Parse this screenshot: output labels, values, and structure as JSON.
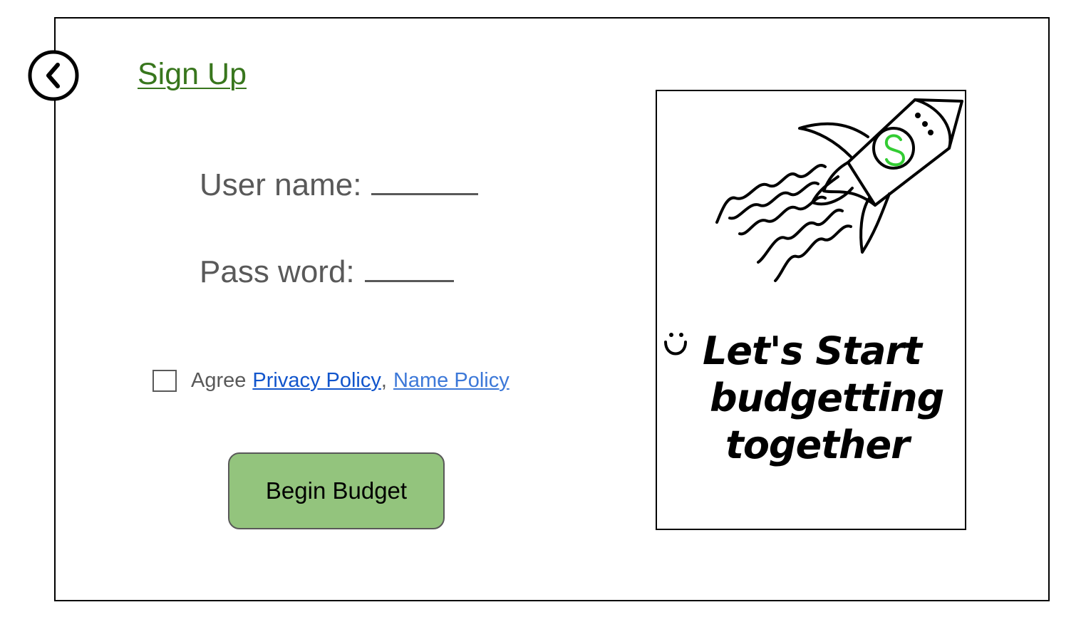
{
  "header": {
    "back_icon": "chevron-left-circle-icon",
    "title": "Sign Up"
  },
  "form": {
    "username_label": "User name:",
    "password_label": "Pass word:",
    "agree_text": "Agree",
    "privacy_link": "Privacy Policy",
    "separator": ",",
    "name_policy_link": "Name Policy",
    "submit_label": "Begin Budget"
  },
  "poster": {
    "icon": "rocket-dollar-icon",
    "line1": "Let's Start",
    "line2": "budgetting",
    "line3": "together",
    "smiley_icon": "smiley-icon"
  },
  "colors": {
    "title": "#38761d",
    "button": "#93c47d",
    "privacy_link": "#1155cc",
    "name_link": "#3c78d8",
    "text": "#595959",
    "dollar": "#33cc33"
  }
}
